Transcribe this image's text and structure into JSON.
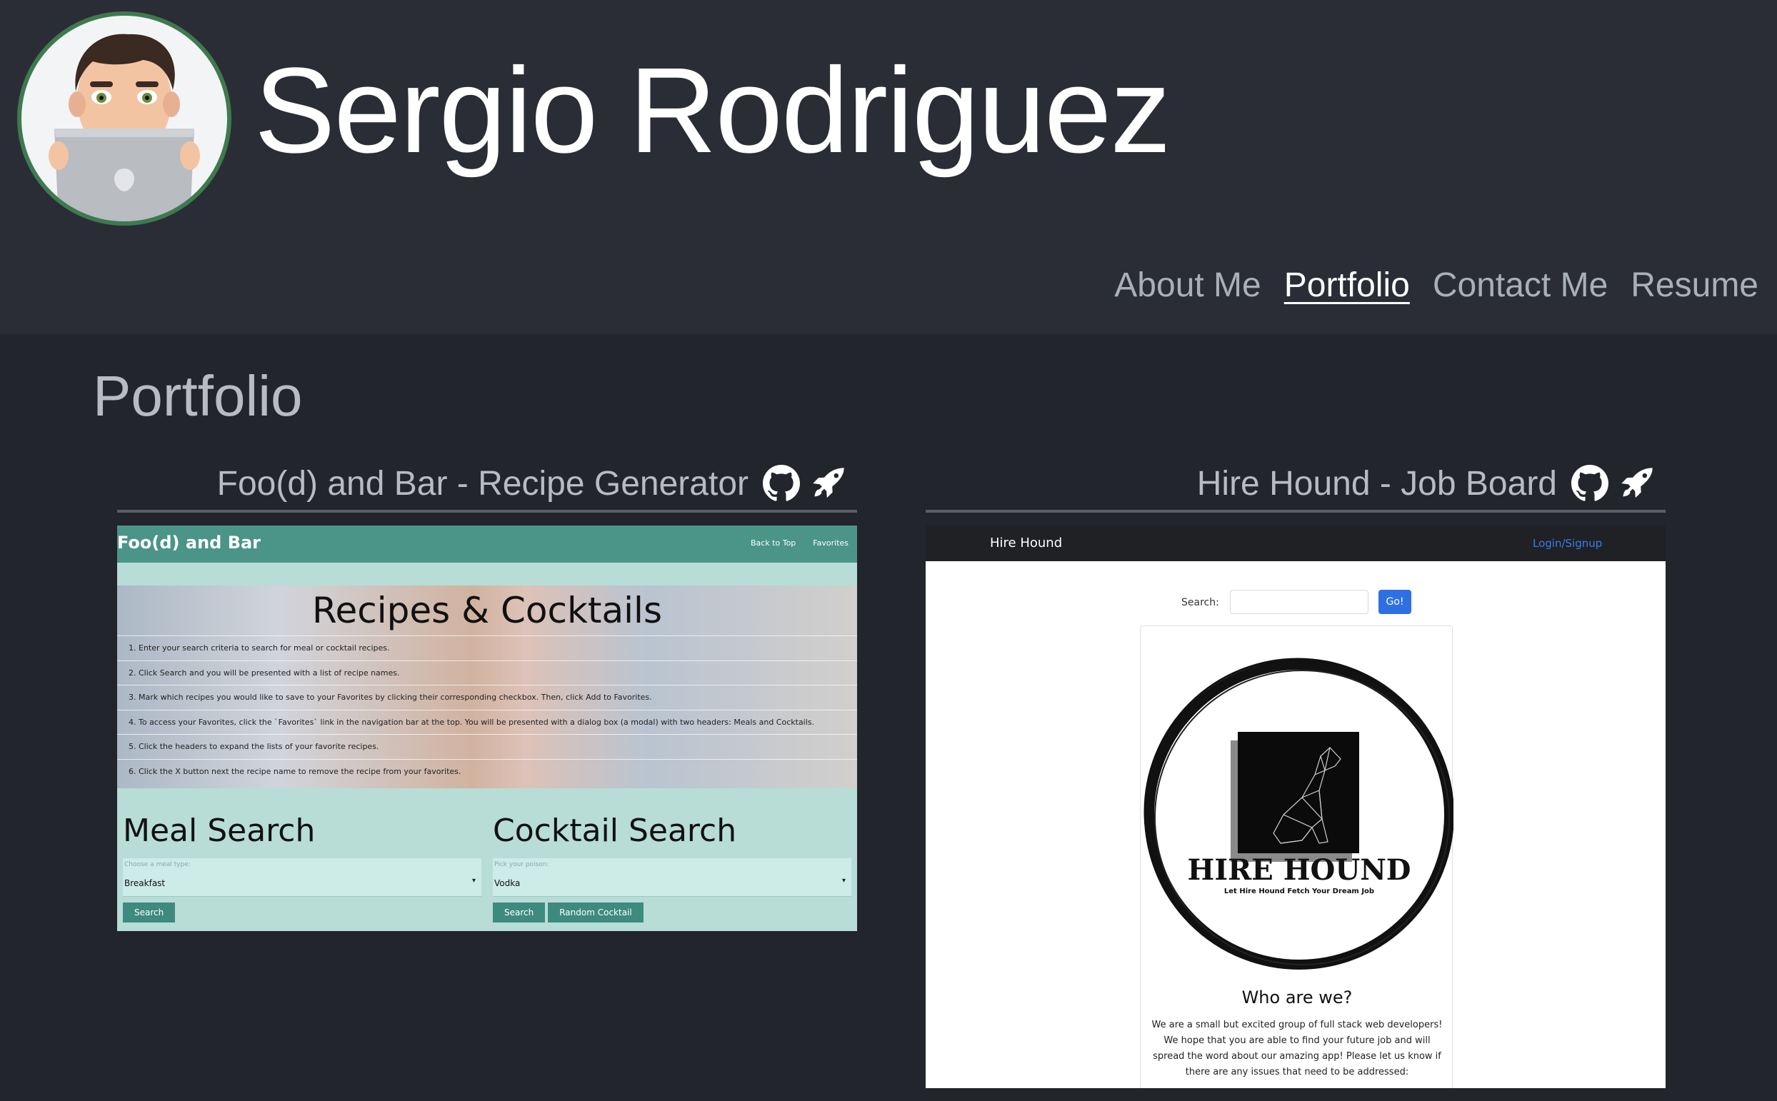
{
  "header": {
    "name": "Sergio Rodriguez",
    "nav": [
      {
        "label": "About Me",
        "active": false
      },
      {
        "label": "Portfolio",
        "active": true
      },
      {
        "label": "Contact Me",
        "active": false
      },
      {
        "label": "Resume",
        "active": false
      }
    ]
  },
  "section": {
    "title": "Portfolio"
  },
  "projects": [
    {
      "title": "Foo(d) and Bar - Recipe Generator",
      "icons": [
        "github-icon",
        "rocket-icon"
      ],
      "screenshot": {
        "brand": "Foo(d) and Bar",
        "nav_links": [
          "Back to Top",
          "Favorites"
        ],
        "hero_title": "Recipes & Cocktails",
        "steps": [
          "1. Enter your search criteria to search for meal or cocktail recipes.",
          "2. Click Search and you will be presented with a list of recipe names.",
          "3. Mark which recipes you would like to save to your Favorites by clicking their corresponding checkbox. Then, click Add to Favorites.",
          "4. To access your Favorites, click the `Favorites` link in the navigation bar at the top. You will be presented with a dialog box (a modal) with two headers: Meals and Cocktails.",
          "5. Click the headers to expand the lists of your favorite recipes.",
          "6. Click the X button next the recipe name to remove the recipe from your favorites."
        ],
        "meal": {
          "heading": "Meal Search",
          "placeholder": "Choose a meal type:",
          "value": "Breakfast",
          "buttons": [
            "Search"
          ]
        },
        "cocktail": {
          "heading": "Cocktail Search",
          "placeholder": "Pick your poison:",
          "value": "Vodka",
          "buttons": [
            "Search",
            "Random Cocktail"
          ]
        }
      }
    },
    {
      "title": "Hire Hound - Job Board",
      "icons": [
        "github-icon",
        "rocket-icon"
      ],
      "screenshot": {
        "brand": "Hire Hound",
        "login": "Login/Signup",
        "search_label": "Search:",
        "go_label": "Go!",
        "logo_title": "HIRE HOUND",
        "logo_tagline": "Let Hire Hound Fetch Your Dream Job",
        "who_heading": "Who are we?",
        "who_text": "We are a small but excited group of full stack web developers! We hope that you are able to find your future job and will spread the word about our amazing app! Please let us know if there are any issues that need to be addressed:"
      }
    }
  ],
  "colors": {
    "page_bg": "#22252c",
    "header_bg": "#2a2d35",
    "avatar_ring": "#3e7a4e",
    "foodbar_teal": "#4a9488",
    "hirehound_button": "#2f6fe4"
  }
}
